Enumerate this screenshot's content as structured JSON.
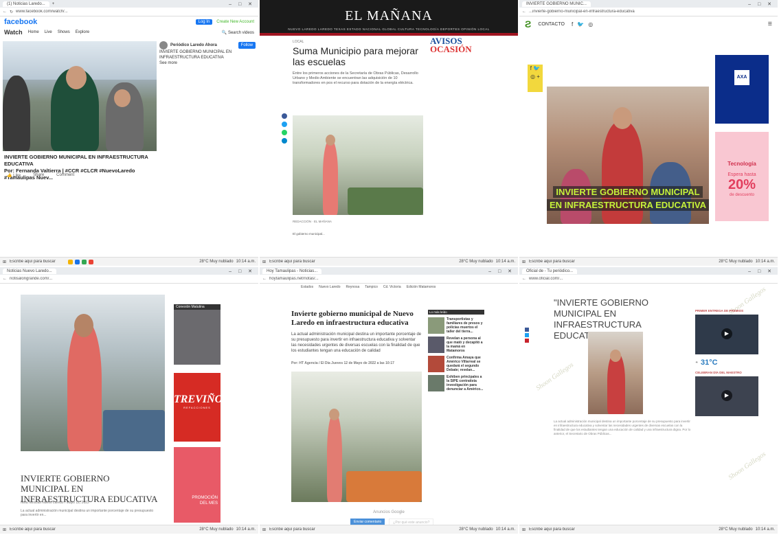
{
  "panels": [
    {
      "tab": "(1) Noticias Laredo...",
      "address": "www.facebook.com/watch/...",
      "facebook": {
        "logo": "facebook",
        "login": "Log In",
        "create": "Create New Account",
        "watch": "Watch",
        "nav": [
          "Home",
          "Live",
          "Shows",
          "Explore"
        ],
        "search": "Search videos",
        "channel": "Periódico Laredo Ahora",
        "side_text": "INVIERTE GOBIERNO MUNICIPAL EN INFRAESTRUCTURA EDUCATIVA",
        "see_more": "See more",
        "follow": "Follow",
        "caption_title": "INVIERTE GOBIERNO MUNICIPAL EN INFRAESTRUCTURA EDUCATIVA",
        "caption_by": "Por: Fernanda Valtierra | #CCR #CLCR #NuevoLaredo #Tamaulipas Nuev...",
        "actions": [
          "Like",
          "Share",
          "Comment"
        ]
      },
      "taskbar": {
        "search": "Escribe aquí para buscar",
        "weather": "28°C Muy nublado",
        "time": "10:14 a.m."
      }
    },
    {
      "tab": "El Mañana",
      "logo": "EL MAÑANA",
      "nav": "NUEVO LAREDO  LAREDO TEXAS  ESTADO  NACIONAL  GLOBAL  CULTURA  TECNOLOGÍA  DEPORTES  OPINIÓN  LOCAL",
      "kicker": "LOCAL",
      "headline": "Suma Municipio para mejorar las escuelas",
      "lede": "Entre los primeros acciones de la Secretaría de Obras Públicas, Desarrollo Urbano y Medio Ambiente se encuentran las adquisición de 10 transformadores en pos el recurso para dotación de la energía eléctrica.",
      "avisos_1": "AVISOS",
      "avisos_2": "OCASIÓN",
      "byline": "REDACCIÓN · EL MAÑANA",
      "foot": "El gobierno municipal...",
      "taskbar": {
        "search": "Escribe aquí para buscar",
        "weather": "28°C Muy nublado",
        "time": "10:14 a.m."
      }
    },
    {
      "tab": "INVIERTE GOBIERNO MUNIC...",
      "address": "...invierte-gobierno-municipal-en-infraestructura-educativa",
      "header_label": "CONTACTO",
      "overlay_1": "INVIERTE GOBIERNO MUNICIPAL",
      "overlay_2": "EN INFRAESTRUCTURA EDUCATIVA",
      "ad_blue": "AXA",
      "ad_pink_1": "Tecnología",
      "ad_pink_2": "Espera hasta",
      "ad_pink_3": "20%",
      "ad_pink_4": "de descuento",
      "taskbar": {
        "search": "Escribe aquí para buscar",
        "weather": "28°C Muy nublado",
        "time": "10:14 a.m."
      }
    },
    {
      "tab": "Noticias Nuevo Laredo...",
      "address": "notisalongrande.com/...",
      "ad_label": "Conexión Matutina",
      "ad_logo": "TREVIÑO",
      "ad_logo_sub": "REFACCIONES",
      "ad_promo_1": "PROMOCIÓN",
      "ad_promo_2": "DEL MES",
      "title": "INVIERTE GOBIERNO MUNICIPAL EN INFRAESTRUCTURA EDUCATIVA",
      "meta": "Nota Noticias Nuevo Laredo / Mayo 12, 2022",
      "text": "La actual administración municipal destina un importante porcentaje de su presupuesto para invertir en...",
      "taskbar": {
        "search": "Escribe aquí para buscar",
        "weather": "28°C Muy nublado",
        "time": "10:14 a.m."
      }
    },
    {
      "tab": "Hoy Tamaulipas - Noticias...",
      "address": "hoytamaulipas.net/notas/...",
      "nav": [
        "Estados",
        "Nuevo Laredo",
        "Reynosa",
        "Tampico",
        "Cd. Victoria",
        "Edición Matamoros"
      ],
      "headline": "Invierte gobierno municipal de Nuevo Laredo en infraestructura educativa",
      "lede": "La actual administración municipal destina un importante porcentaje de su presupuesto para invertir en infraestructura educativa y solventar las necesidades urgentes de diversas escuelas con la finalidad de que los estudiantes tengan una educación de calidad",
      "byline": "Por: HT Agencia / El Día Jueves 12 de Mayo de 2022 a las 10:17",
      "side_header": "Lo más leído",
      "side_items": [
        "Transportistas y familiares de presos y policías muertos el taller del tierra...",
        "Revelan a persona al que mató y decapitó a la mamá en Matamoros",
        "Confirma Amaya que Américo Villarreal se quedará el segundo Debate; revelan...",
        "Exhiben principales a la SIPE contratista investigación para denunciar a Américo..."
      ],
      "google": "Anuncios Google",
      "send": "Enviar comentario",
      "other": "¿Por qué este anuncio?",
      "taskbar": {
        "search": "Escribe aquí para buscar",
        "weather": "28°C Muy nublado",
        "time": "10:14 a.m."
      }
    },
    {
      "tab": "Oficial de - Tu periódico...",
      "address": "www.oficial.com/...",
      "headline": "\"INVIERTE GOBIERNO MUNICIPAL EN INFRAESTRUCTURA EDUCATIVA\"",
      "body": "La actual administración municipal destina un importante porcentaje de su presupuesto para invertir en infraestructura educativa y solventar las necesidades urgentes de diversas escuelas con la finalidad de que los estudiantes tengan una educación de calidad y una infraestructura digna. Por lo anterior, el Secretario de Obras Públicas...",
      "side_label_1": "PRIMER ENTREGA DE PREMIOS",
      "side_label_2": "CELEBRAN DÍA DEL MAESTRO",
      "temp": "31°C",
      "watermark": "Shoon Gallegos",
      "taskbar": {
        "search": "Escribe aquí para buscar",
        "weather": "28°C Muy nublado",
        "time": "10:14 a.m."
      }
    }
  ]
}
